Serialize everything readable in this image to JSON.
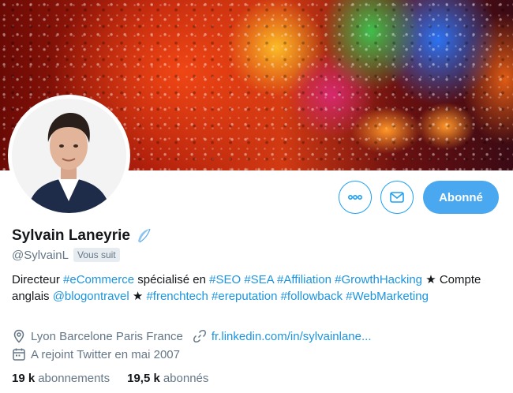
{
  "profile": {
    "name": "Sylvain Laneyrie",
    "handle": "@SylvainL",
    "follows_you": "Vous suit",
    "bio": [
      {
        "t": "Directeur ",
        "tag": false
      },
      {
        "t": "#eCommerce",
        "tag": true
      },
      {
        "t": " spécialisé en ",
        "tag": false
      },
      {
        "t": "#SEO",
        "tag": true
      },
      {
        "t": " ",
        "tag": false
      },
      {
        "t": "#SEA",
        "tag": true
      },
      {
        "t": " ",
        "tag": false
      },
      {
        "t": "#Affiliation",
        "tag": true
      },
      {
        "t": " ",
        "tag": false
      },
      {
        "t": "#GrowthHacking",
        "tag": true
      },
      {
        "t": " ★ Compte anglais ",
        "tag": false
      },
      {
        "t": "@blogontravel",
        "tag": true
      },
      {
        "t": " ★ ",
        "tag": false
      },
      {
        "t": "#frenchtech",
        "tag": true
      },
      {
        "t": " ",
        "tag": false
      },
      {
        "t": "#ereputation",
        "tag": true
      },
      {
        "t": " ",
        "tag": false
      },
      {
        "t": "#followback",
        "tag": true
      },
      {
        "t": " ",
        "tag": false
      },
      {
        "t": "#WebMarketing",
        "tag": true
      }
    ],
    "location": "Lyon Barcelone Paris France",
    "url": "fr.linkedin.com/in/sylvainlane...",
    "joined": "A rejoint Twitter en mai 2007",
    "following_count": "19 k",
    "following_label": "abonnements",
    "followers_count": "19,5 k",
    "followers_label": "abonnés"
  },
  "actions": {
    "follow_label": "Abonné",
    "more_icon": "more-icon",
    "message_icon": "mail-icon"
  },
  "colors": {
    "accent": "#1da1f2",
    "follow_bg": "#4aa8f0",
    "link": "#1b95e0",
    "muted": "#657786"
  }
}
